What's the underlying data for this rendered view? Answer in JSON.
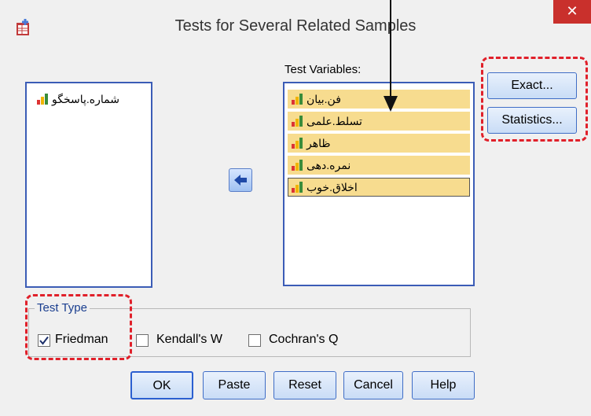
{
  "window": {
    "title": "Tests for Several Related Samples",
    "close_label": "✕"
  },
  "source_list": {
    "items": [
      {
        "label": "شماره.پاسخگو",
        "icon": "scale-variable-icon"
      }
    ]
  },
  "target_list": {
    "label": "Test Variables:",
    "items": [
      {
        "label": "فن.بیان",
        "icon": "scale-variable-icon"
      },
      {
        "label": "تسلط.علمی",
        "icon": "scale-variable-icon"
      },
      {
        "label": "ظاهر",
        "icon": "scale-variable-icon"
      },
      {
        "label": "نمره.دهی",
        "icon": "scale-variable-icon"
      },
      {
        "label": "اخلاق.خوب",
        "icon": "scale-variable-icon"
      }
    ]
  },
  "side_buttons": {
    "exact": "Exact...",
    "statistics": "Statistics..."
  },
  "test_type": {
    "title": "Test Type",
    "options": [
      {
        "label": "Friedman",
        "checked": true
      },
      {
        "label": "Kendall's W",
        "checked": false
      },
      {
        "label": "Cochran's Q",
        "checked": false
      }
    ]
  },
  "buttons": {
    "ok": "OK",
    "paste": "Paste",
    "reset": "Reset",
    "cancel": "Cancel",
    "help": "Help"
  },
  "colors": {
    "highlight": "#e0202a",
    "selection": "#f7dc8f",
    "list_border": "#3b5cb6"
  }
}
